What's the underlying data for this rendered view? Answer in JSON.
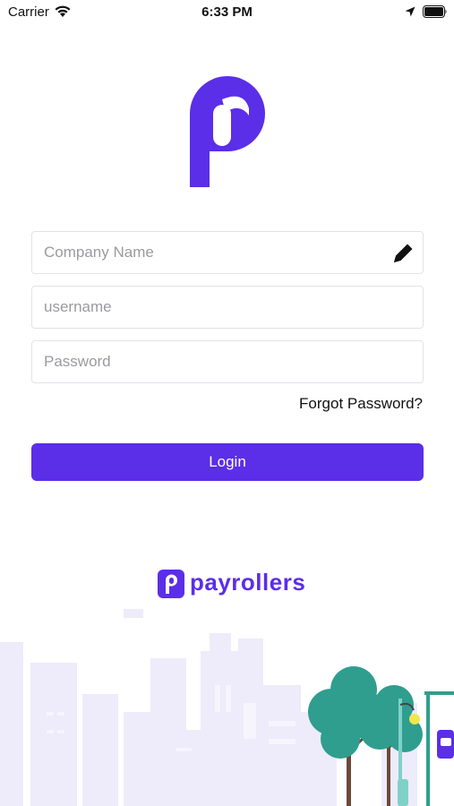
{
  "status_bar": {
    "carrier": "Carrier",
    "time": "6:33 PM",
    "icons": [
      "wifi-icon",
      "location-arrow-icon",
      "battery-icon"
    ]
  },
  "logo": {
    "icon": "payrollers-p-logo"
  },
  "form": {
    "company": {
      "placeholder": "Company Name",
      "value": "",
      "icon": "pencil-edit-icon"
    },
    "username": {
      "placeholder": "username",
      "value": ""
    },
    "password": {
      "placeholder": "Password",
      "value": ""
    },
    "forgot_label": "Forgot Password?",
    "login_label": "Login"
  },
  "brand": {
    "name": "payrollers",
    "icon": "payrollers-small-logo"
  },
  "illustration": "city-skyline-with-trees-and-bus-stop",
  "colors": {
    "accent": "#5b2ee8",
    "field_border": "#e3e3e8",
    "skyline": "#eeebfa",
    "tree": "#2f9e8f",
    "tree_trunk": "#6b4a3a"
  }
}
